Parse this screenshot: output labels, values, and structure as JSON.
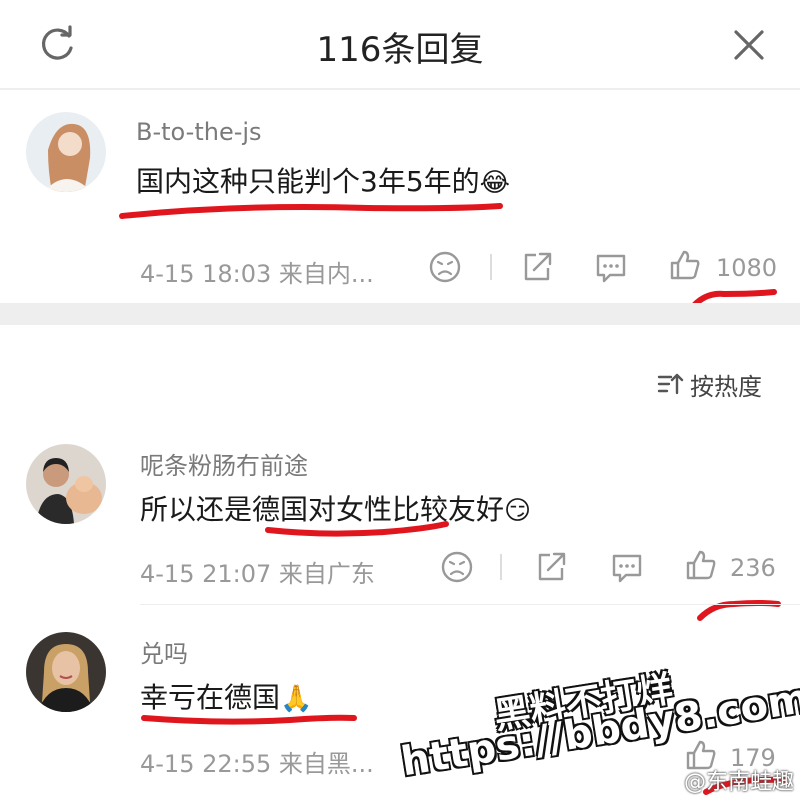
{
  "header": {
    "title": "116条回复",
    "refresh_icon": "refresh-icon",
    "close_icon": "close-icon"
  },
  "main_comment": {
    "username": "B-to-the-js",
    "text": "国内这种只能判个3年5年的",
    "emoji": "😂",
    "meta": "4-15 18:03 来自内...",
    "likes": "1080"
  },
  "sort": {
    "label": "按热度",
    "icon": "sort-icon"
  },
  "replies": [
    {
      "username": "呢条粉肠冇前途",
      "text": "所以还是德国对女性比较友好",
      "emoji": "😏",
      "meta": "4-15 21:07 来自广东",
      "likes": "236"
    },
    {
      "username": "兑吗",
      "text": "幸亏在德国",
      "emoji": "🙏",
      "meta": "4-15 22:55 来自黑...",
      "likes": "179"
    }
  ],
  "watermark": {
    "line1": "黑料不打烊",
    "line2": "https://bbdy8.com"
  },
  "weibo_mark": "@东南蛙趣",
  "colors": {
    "annotation_red": "#e0161e",
    "meta_gray": "#999999",
    "divider": "#eeeeee"
  }
}
